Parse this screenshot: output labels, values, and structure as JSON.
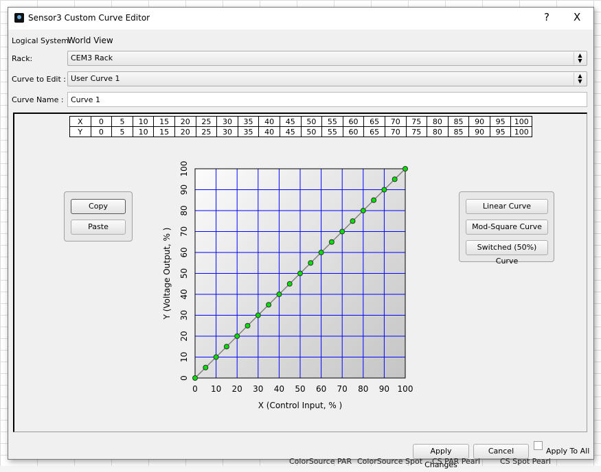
{
  "window": {
    "title": "Sensor3 Custom Curve Editor",
    "help": "?",
    "close": "X"
  },
  "form": {
    "logical_system_label": "Logical System:",
    "logical_system_value": "World View",
    "rack_label": "Rack:",
    "rack_value": "CEM3 Rack",
    "curve_label": "Curve to Edit :",
    "curve_value": "User Curve 1",
    "name_label": "Curve Name :",
    "name_value": "Curve 1"
  },
  "table": {
    "x_label": "X",
    "y_label": "Y",
    "x": [
      "0",
      "5",
      "10",
      "15",
      "20",
      "25",
      "30",
      "35",
      "40",
      "45",
      "50",
      "55",
      "60",
      "65",
      "70",
      "75",
      "80",
      "85",
      "90",
      "95",
      "100"
    ],
    "y": [
      "0",
      "5",
      "10",
      "15",
      "20",
      "25",
      "30",
      "35",
      "40",
      "45",
      "50",
      "55",
      "60",
      "65",
      "70",
      "75",
      "80",
      "85",
      "90",
      "95",
      "100"
    ]
  },
  "left_buttons": {
    "copy": "Copy",
    "paste": "Paste"
  },
  "right_buttons": {
    "linear": "Linear Curve",
    "modsquare": "Mod-Square Curve",
    "switched": "Switched (50%) Curve"
  },
  "footer": {
    "apply": "Apply Changes",
    "cancel": "Cancel",
    "apply_all": "Apply To All",
    "apply_all_checked": false
  },
  "background_text": [
    "ColorSource PAR",
    "ColorSource Spot",
    "CS PAR Pearl",
    "CS Spot Pearl"
  ],
  "chart_data": {
    "type": "line",
    "xlabel": "X  (Control Input, % )",
    "ylabel": "Y  (Voltage Output, % )",
    "xlim": [
      0,
      100
    ],
    "ylim": [
      0,
      100
    ],
    "xticks": [
      0,
      10,
      20,
      30,
      40,
      50,
      60,
      70,
      80,
      90,
      100
    ],
    "yticks": [
      0,
      10,
      20,
      30,
      40,
      50,
      60,
      70,
      80,
      90,
      100
    ],
    "grid": true,
    "x": [
      0,
      5,
      10,
      15,
      20,
      25,
      30,
      35,
      40,
      45,
      50,
      55,
      60,
      65,
      70,
      75,
      80,
      85,
      90,
      95,
      100
    ],
    "y": [
      0,
      5,
      10,
      15,
      20,
      25,
      30,
      35,
      40,
      45,
      50,
      55,
      60,
      65,
      70,
      75,
      80,
      85,
      90,
      95,
      100
    ],
    "colors": {
      "grid": "#0000ff",
      "line": "#808080",
      "point": "#00e000"
    }
  }
}
